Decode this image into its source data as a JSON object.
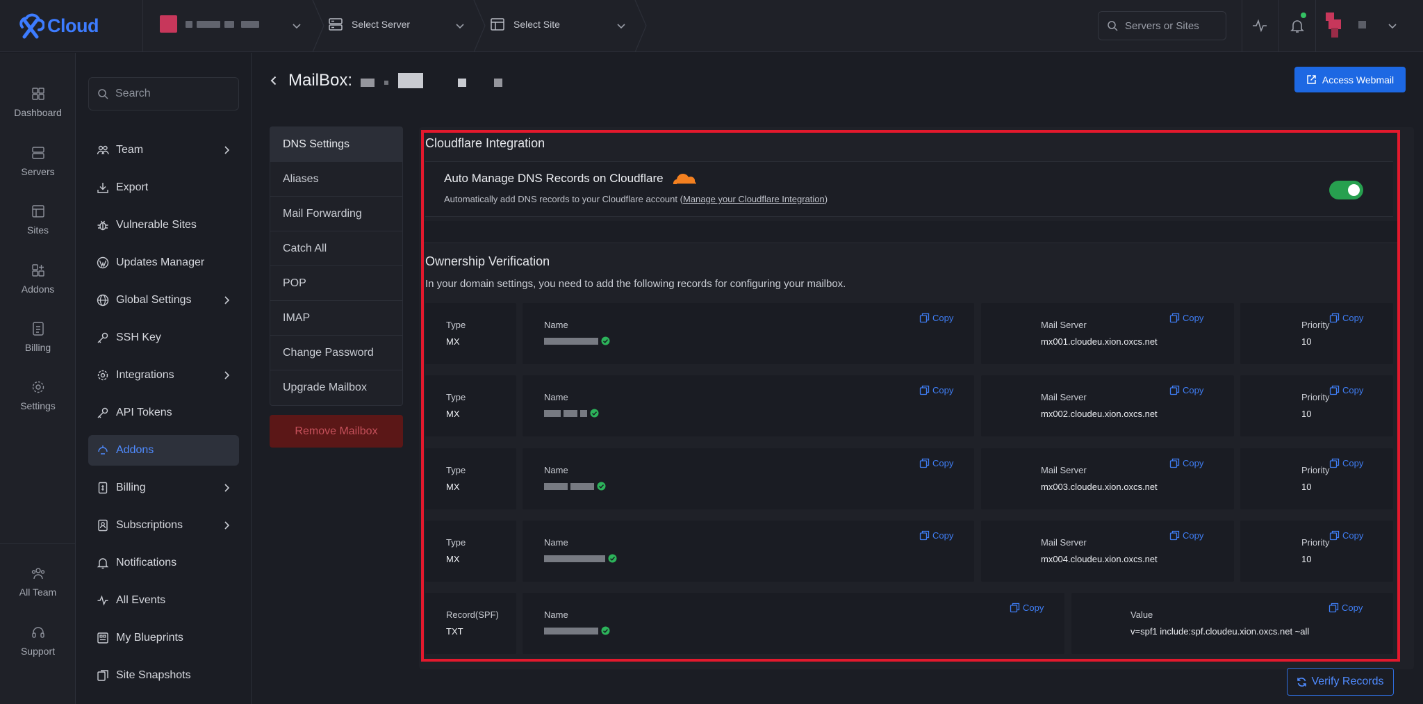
{
  "app": {
    "logo_text": "Cloud"
  },
  "topbar": {
    "select_server": "Select Server",
    "select_site": "Select Site",
    "search_placeholder": "Servers or Sites"
  },
  "rail": [
    {
      "label": "Dashboard"
    },
    {
      "label": "Servers"
    },
    {
      "label": "Sites"
    },
    {
      "label": "Addons"
    },
    {
      "label": "Billing"
    },
    {
      "label": "Settings"
    },
    {
      "label": "All Team"
    },
    {
      "label": "Support"
    }
  ],
  "sidebar": {
    "search_placeholder": "Search",
    "items": [
      {
        "label": "Team"
      },
      {
        "label": "Export"
      },
      {
        "label": "Vulnerable Sites"
      },
      {
        "label": "Updates Manager"
      },
      {
        "label": "Global Settings"
      },
      {
        "label": "SSH Key"
      },
      {
        "label": "Integrations"
      },
      {
        "label": "API Tokens"
      },
      {
        "label": "Addons"
      },
      {
        "label": "Billing"
      },
      {
        "label": "Subscriptions"
      },
      {
        "label": "Notifications"
      },
      {
        "label": "All Events"
      },
      {
        "label": "My Blueprints"
      },
      {
        "label": "Site Snapshots"
      }
    ]
  },
  "page": {
    "title": "MailBox:",
    "webmail_label": "Access Webmail"
  },
  "tabs": [
    {
      "label": "DNS Settings"
    },
    {
      "label": "Aliases"
    },
    {
      "label": "Mail Forwarding"
    },
    {
      "label": "Catch All"
    },
    {
      "label": "POP"
    },
    {
      "label": "IMAP"
    },
    {
      "label": "Change Password"
    },
    {
      "label": "Upgrade Mailbox"
    }
  ],
  "remove_label": "Remove Mailbox",
  "cloudflare": {
    "section_title": "Cloudflare Integration",
    "card_title": "Auto Manage DNS Records on Cloudflare",
    "desc_prefix": "Automatically add DNS records to your Cloudflare account (",
    "desc_link": "Manage your Cloudflare Integration",
    "desc_suffix": ")",
    "toggle_on": true,
    "accent": "#27a04f"
  },
  "ownership": {
    "title": "Ownership Verification",
    "desc": "In your domain settings, you need to add the following records for configuring your mailbox.",
    "copy_label": "Copy",
    "mx_records": [
      {
        "type_label": "Type",
        "type": "MX",
        "name_label": "Name",
        "server_label": "Mail Server",
        "server": "mx001.cloudeu.xion.oxcs.net",
        "priority_label": "Priority",
        "priority": "10"
      },
      {
        "type_label": "Type",
        "type": "MX",
        "name_label": "Name",
        "server_label": "Mail Server",
        "server": "mx002.cloudeu.xion.oxcs.net",
        "priority_label": "Priority",
        "priority": "10"
      },
      {
        "type_label": "Type",
        "type": "MX",
        "name_label": "Name",
        "server_label": "Mail Server",
        "server": "mx003.cloudeu.xion.oxcs.net",
        "priority_label": "Priority",
        "priority": "10"
      },
      {
        "type_label": "Type",
        "type": "MX",
        "name_label": "Name",
        "server_label": "Mail Server",
        "server": "mx004.cloudeu.xion.oxcs.net",
        "priority_label": "Priority",
        "priority": "10"
      }
    ],
    "spf": {
      "type_label": "Record(SPF)",
      "type": "TXT",
      "name_label": "Name",
      "value_label": "Value",
      "value": "v=spf1 include:spf.cloudeu.xion.oxcs.net ~all"
    }
  },
  "verify_label": "Verify Records"
}
